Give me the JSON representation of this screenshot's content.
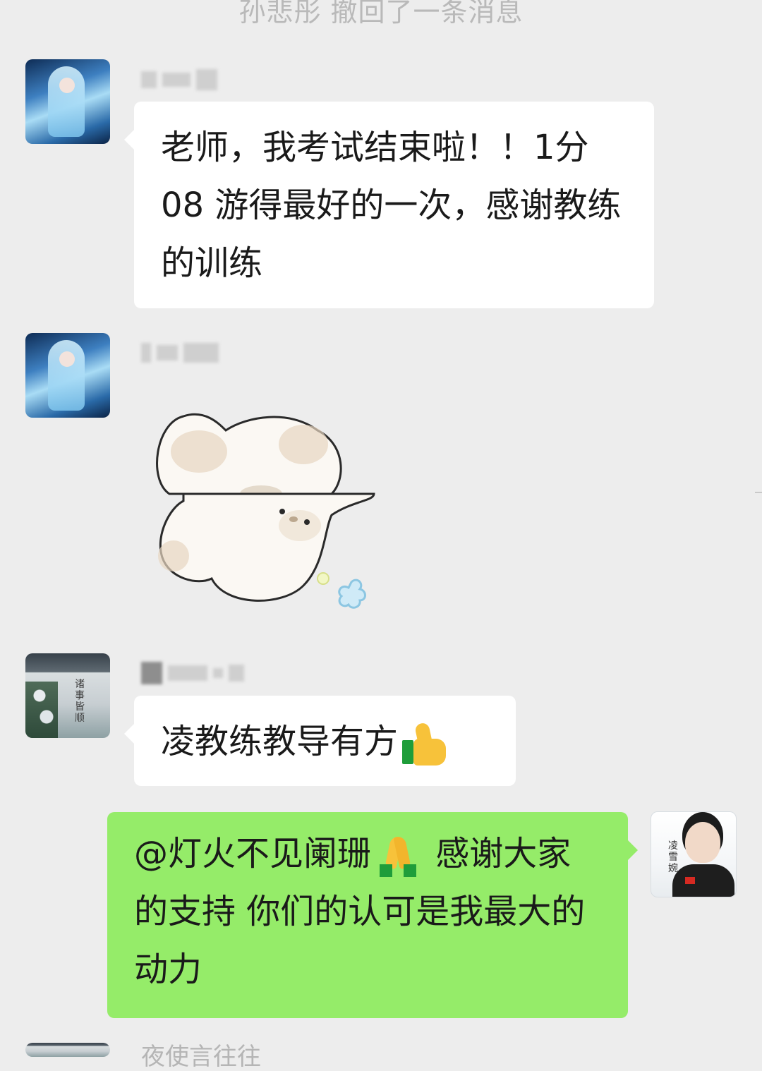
{
  "system_notice": "孙悲彤 撤回了一条消息",
  "messages": [
    {
      "text": "老师，我考试结束啦！！1分08 游得最好的一次，感谢教练的训练"
    },
    {
      "type": "sticker",
      "icon": "white-cat-sticker"
    },
    {
      "text": "凌教练教导有方",
      "emoji": "thumbs-up-icon"
    },
    {
      "mention": "@灯火不见阑珊",
      "emoji": "pray-icon",
      "text": " 感谢大家的支持  你们的认可是我最大的动力"
    }
  ],
  "coach_avatar_name": "凌雪婉",
  "partial_next_sender": "夜使言往往",
  "colors": {
    "background": "#ededed",
    "incoming_bubble": "#ffffff",
    "outgoing_bubble": "#95ec69"
  }
}
